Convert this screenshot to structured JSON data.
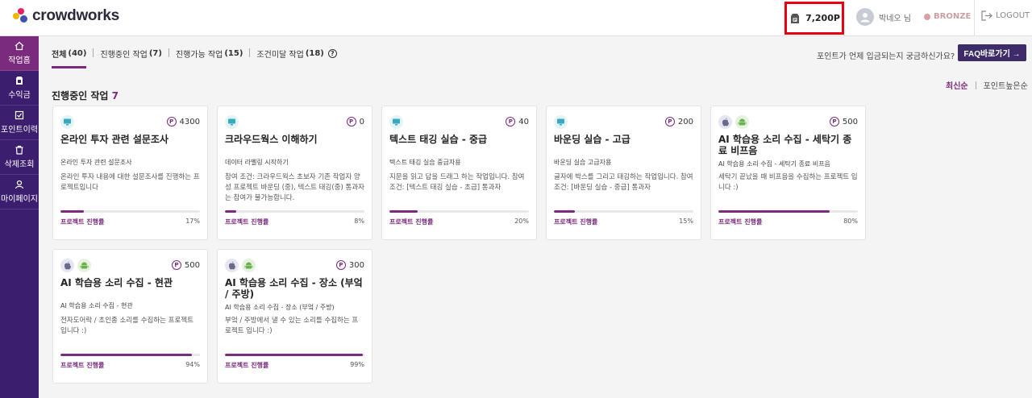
{
  "app": {
    "logo_text": "crowdworks"
  },
  "header": {
    "points": "7,200P",
    "user_name": "박네오 님",
    "grade": "BRONZE",
    "logout": "LOGOUT"
  },
  "sidebar": {
    "items": [
      {
        "label": "작업홈",
        "icon": "home-icon",
        "active": true
      },
      {
        "label": "수익금",
        "icon": "money-bag-icon",
        "active": false
      },
      {
        "label": "포인트이력",
        "icon": "point-history-icon",
        "active": false
      },
      {
        "label": "삭제조회",
        "icon": "trash-icon",
        "active": false
      },
      {
        "label": "마이페이지",
        "icon": "user-icon",
        "active": false
      }
    ]
  },
  "tabs": [
    {
      "label": "전체",
      "count": "(40)",
      "active": true
    },
    {
      "label": "진행중인 작업",
      "count": "(7)",
      "active": false
    },
    {
      "label": "진행가능 작업",
      "count": "(15)",
      "active": false
    },
    {
      "label": "조건미달 작업",
      "count": "(18)",
      "active": false
    }
  ],
  "faq": {
    "question": "포인트가 언제 입금되는지 궁금하신가요?",
    "button": "FAQ바로가기 →"
  },
  "sort": {
    "latest": "최신순",
    "points": "포인트높은순"
  },
  "section": {
    "title": "진행중인 작업",
    "count": "7"
  },
  "colors": {
    "accent": "#7b2b7d",
    "sidebar": "#3c1e6e",
    "highlight_border": "#e60012"
  },
  "cards": [
    {
      "platforms": [
        "pc"
      ],
      "reward": "4300",
      "title": "온라인 투자 관련 설문조사",
      "subtitle": "온라인 투자 관련 설문조사",
      "desc": "온라인 투자 내용에 대한 설문조사를 진행하는 프로젝트입니다",
      "progress_label": "프로젝트 진행률",
      "progress": 17,
      "progress_text": "17%"
    },
    {
      "platforms": [
        "pc"
      ],
      "reward": "0",
      "title": "크라우드웍스 이해하기",
      "subtitle": "데이터 라벨링 시작하기",
      "desc": "참여 조건: 크라우드웍스 초보자 기존 작업자 양성 프로젝트 바운딩 (중), 텍스트 태깅(중) 통과자는 참여가 불가능합니다.",
      "progress_label": "프로젝트 진행률",
      "progress": 8,
      "progress_text": "8%"
    },
    {
      "platforms": [
        "pc"
      ],
      "reward": "40",
      "title": "텍스트 태깅 실습 - 중급",
      "subtitle": "텍스트 태깅 실습 중급자용",
      "desc": "지문을 읽고 답을 드래그 하는 작업입니다. 참여조건: [텍스트 태깅 실습 - 초급] 통과자",
      "progress_label": "프로젝트 진행률",
      "progress": 20,
      "progress_text": "20%"
    },
    {
      "platforms": [
        "pc"
      ],
      "reward": "200",
      "title": "바운딩 실습 - 고급",
      "subtitle": "바운딩 실습 고급자용",
      "desc": "글자에 박스를 그리고 태깅하는 작업입니다. 참여조건: [바운딩 실습 - 중급] 통과자",
      "progress_label": "프로젝트 진행률",
      "progress": 15,
      "progress_text": "15%"
    },
    {
      "platforms": [
        "ios",
        "android"
      ],
      "reward": "500",
      "title": "AI 학습용 소리 수집 - 세탁기 종료 비프음",
      "subtitle": "AI 학습용 소리 수집 - 세탁기 종료 비프음",
      "desc": "세탁기 끝났을 때 비프음을 수집하는 프로젝트 입니다 :)",
      "progress_label": "프로젝트 진행률",
      "progress": 80,
      "progress_text": "80%"
    },
    {
      "platforms": [
        "ios",
        "android"
      ],
      "reward": "500",
      "title": "AI 학습용 소리 수집 - 현관",
      "subtitle": "AI 학습용 소리 수집 - 현관",
      "desc": "전자도어락 / 초인종 소리를 수집하는 프로젝트 입니다 :)",
      "progress_label": "프로젝트 진행률",
      "progress": 94,
      "progress_text": "94%"
    },
    {
      "platforms": [
        "ios",
        "android"
      ],
      "reward": "300",
      "title": "AI 학습용 소리 수집 - 장소 (부엌 / 주방)",
      "subtitle": "AI 학습용 소리 수집 - 장소 (부엌 / 주방)",
      "desc": "부엌 / 주방에서 낼 수 있는 소리를 수집하는 프로젝트 입니다 :)",
      "progress_label": "프로젝트 진행률",
      "progress": 99,
      "progress_text": "99%"
    }
  ]
}
